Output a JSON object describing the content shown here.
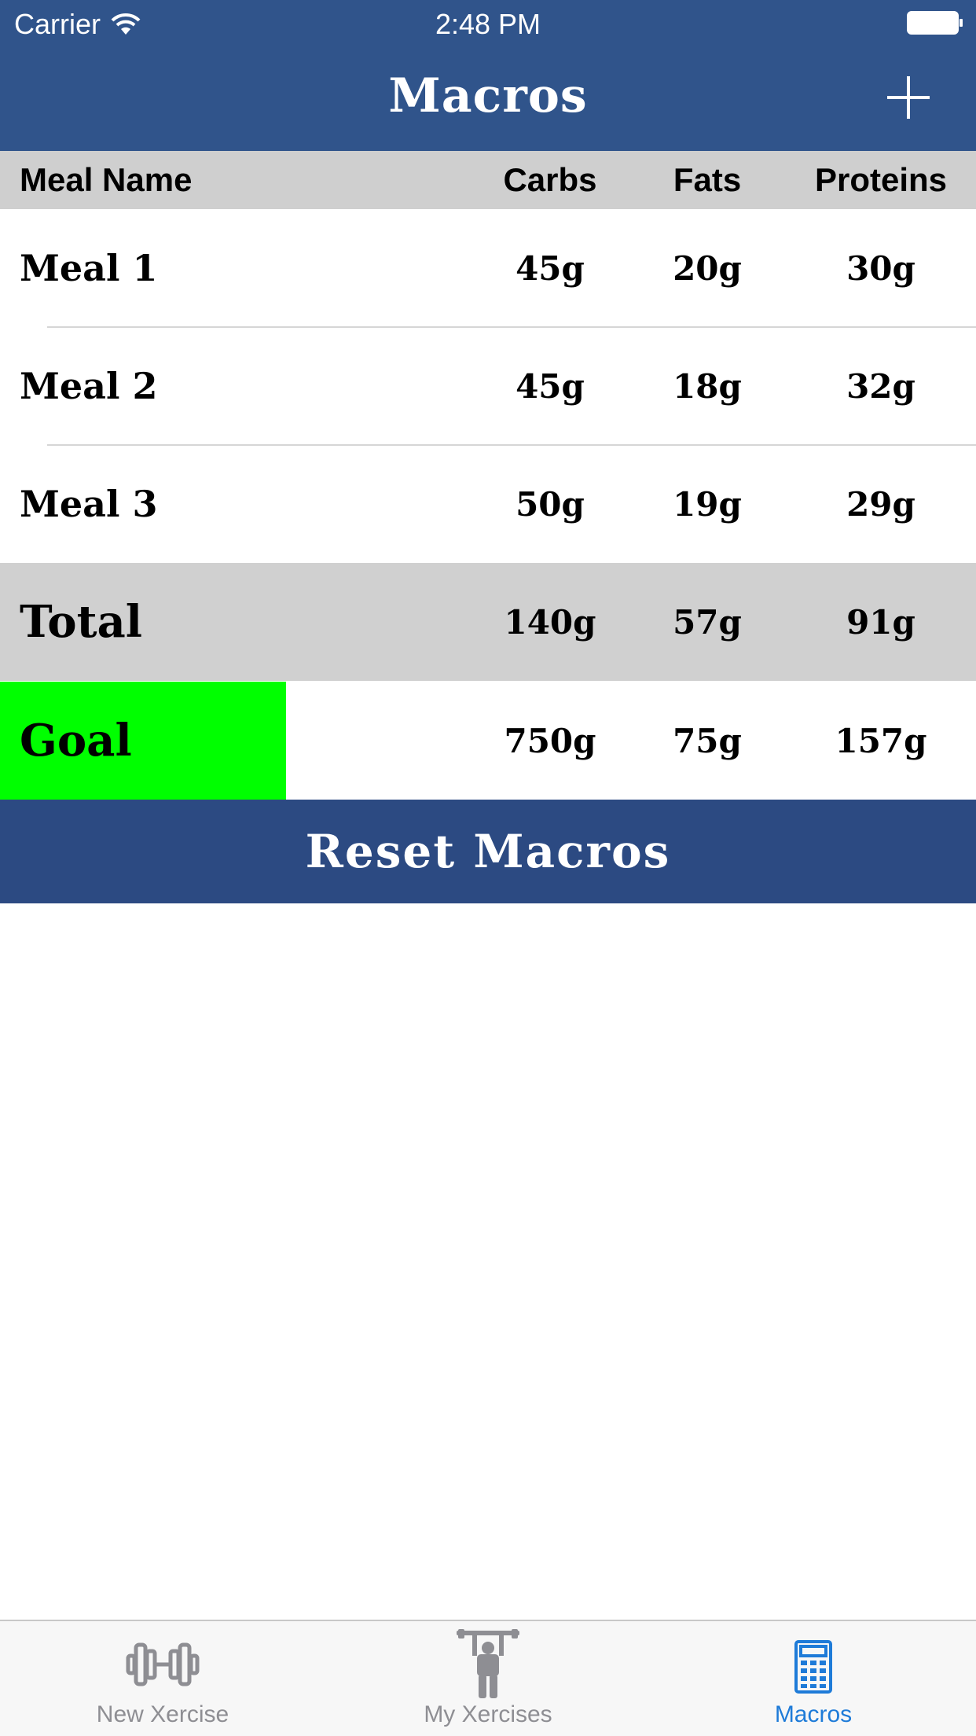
{
  "status_bar": {
    "carrier": "Carrier",
    "time": "2:48 PM"
  },
  "nav": {
    "title": "Macros"
  },
  "table": {
    "headers": {
      "name": "Meal Name",
      "carbs": "Carbs",
      "fats": "Fats",
      "proteins": "Proteins"
    },
    "meals": [
      {
        "name": "Meal 1",
        "carbs": "45g",
        "fats": "20g",
        "proteins": "30g"
      },
      {
        "name": "Meal 2",
        "carbs": "45g",
        "fats": "18g",
        "proteins": "32g"
      },
      {
        "name": "Meal 3",
        "carbs": "50g",
        "fats": "19g",
        "proteins": "29g"
      }
    ],
    "total": {
      "name": "Total",
      "carbs": "140g",
      "fats": "57g",
      "proteins": "91g"
    },
    "goal": {
      "name": "Goal",
      "carbs": "750g",
      "fats": "75g",
      "proteins": "157g"
    }
  },
  "reset_label": "Reset Macros",
  "tabs": [
    {
      "label": "New Xercise",
      "icon": "dumbbell-icon"
    },
    {
      "label": "My Xercises",
      "icon": "weightlifter-icon"
    },
    {
      "label": "Macros",
      "icon": "calculator-icon",
      "active": true
    }
  ],
  "colors": {
    "header": "#30548b",
    "reset_button": "#2c4a82",
    "goal_highlight": "#00ff00",
    "table_header": "#cfcfcf",
    "total_row": "#d0d0d0",
    "tab_active": "#1e7bd8",
    "tab_inactive": "#8e8e93"
  }
}
